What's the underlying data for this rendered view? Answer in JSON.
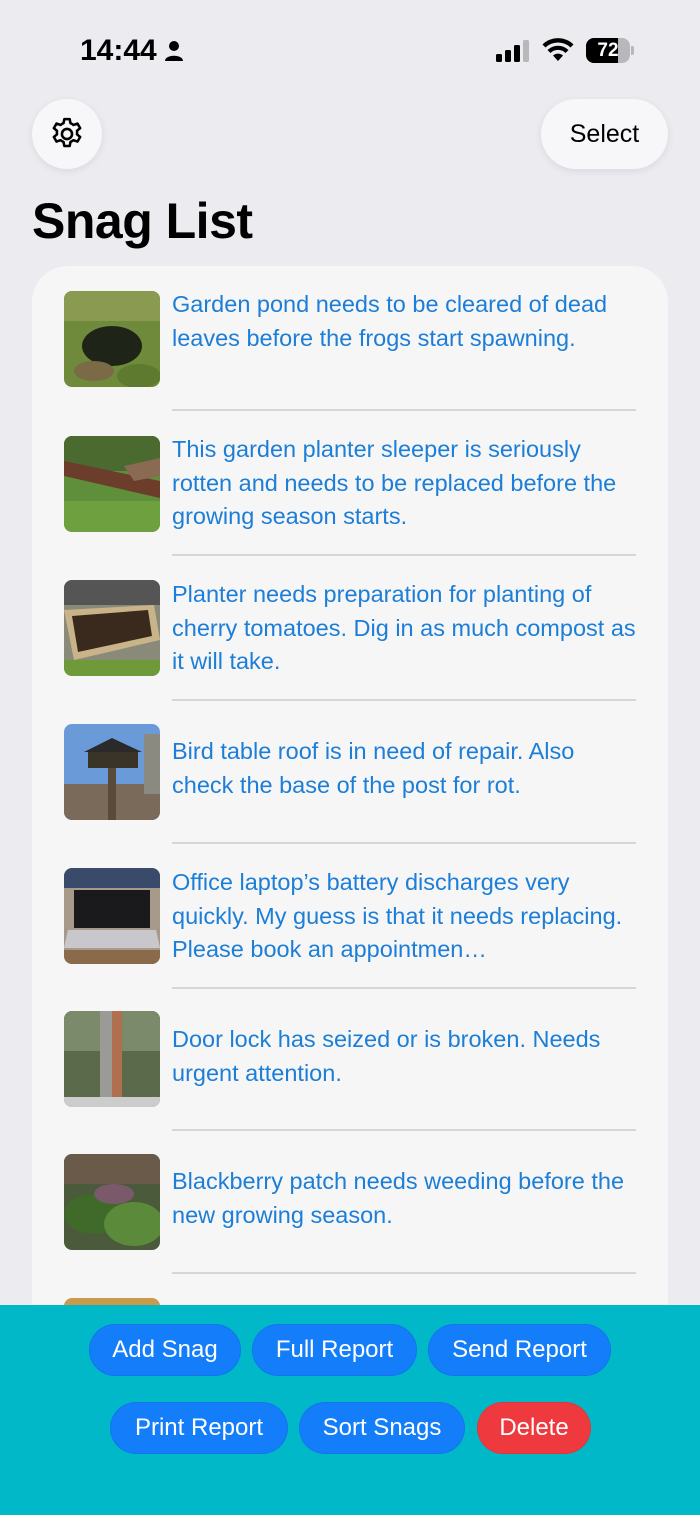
{
  "status_bar": {
    "time": "14:44",
    "battery_level": "72",
    "icons": [
      "person-icon",
      "signal-icon",
      "wifi-icon",
      "battery-icon"
    ]
  },
  "header": {
    "settings_icon": "gear-icon",
    "select_label": "Select",
    "title": "Snag List"
  },
  "snags": [
    {
      "text": "Garden pond needs to be cleared of dead leaves before the frogs start spawning.",
      "thumbnail": "garden-pond-photo"
    },
    {
      "text": "This garden planter sleeper is seriously rotten and needs to be replaced before the growing season starts.",
      "thumbnail": "planter-sleeper-photo"
    },
    {
      "text": "Planter needs preparation for planting of cherry tomatoes. Dig in as much compost as it will take.",
      "thumbnail": "planter-soil-photo"
    },
    {
      "text": "Bird table roof is in need of repair.  Also check the base of the post for rot.",
      "thumbnail": "bird-table-photo"
    },
    {
      "text": "Office laptop’s battery discharges very quickly. My guess is that it needs replacing. Please book an appointmen…",
      "thumbnail": "laptop-photo"
    },
    {
      "text": "Door lock has seized or is broken. Needs urgent attention.",
      "thumbnail": "door-lock-photo"
    },
    {
      "text": "Blackberry patch needs weeding before the new growing season.",
      "thumbnail": "blackberry-patch-photo"
    }
  ],
  "toolbar": {
    "add_snag": "Add Snag",
    "full_report": "Full Report",
    "send_report": "Send Report",
    "print_report": "Print Report",
    "sort_snags": "Sort Snags",
    "delete": "Delete"
  },
  "colors": {
    "background": "#ebebf0",
    "card": "#f6f6f7",
    "link_text": "#1c7ed6",
    "toolbar": "#00b8c8",
    "button": "#147dfa",
    "delete_button": "#ee3a3f"
  }
}
